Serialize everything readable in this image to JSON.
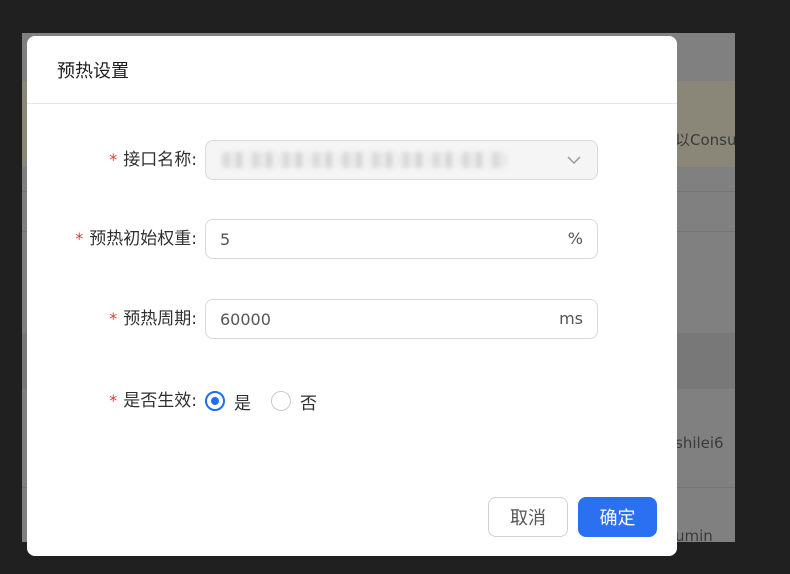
{
  "background": {
    "fragments": [
      "以Consu",
      "shilei6",
      "umin"
    ]
  },
  "modal": {
    "title": "预热设置",
    "fields": {
      "interface_name": {
        "label": "接口名称:",
        "required_mark": "*"
      },
      "initial_weight": {
        "label": "预热初始权重:",
        "required_mark": "*",
        "value": "5",
        "suffix": "%"
      },
      "period": {
        "label": "预热周期:",
        "required_mark": "*",
        "value": "60000",
        "suffix": "ms"
      },
      "enabled": {
        "label": "是否生效:",
        "required_mark": "*",
        "options": [
          {
            "label": "是",
            "checked": true
          },
          {
            "label": "否",
            "checked": false
          }
        ]
      }
    },
    "buttons": {
      "cancel": "取消",
      "ok": "确定"
    }
  },
  "colors": {
    "primary": "#2b6ff2",
    "required": "#e53935"
  }
}
